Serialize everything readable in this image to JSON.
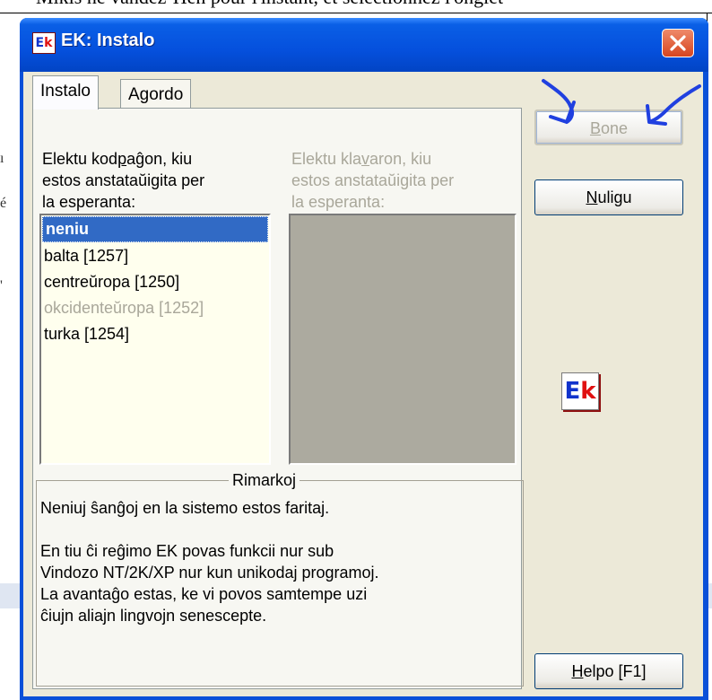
{
  "background": {
    "top_text": "Mikis ne vandez-Hen pour l'instant, et sélectionnez l'onglet"
  },
  "window": {
    "title": "EK: Instalo",
    "icon_text_e": "E",
    "icon_text_k": "k",
    "close_icon": "close-x-icon"
  },
  "tabs": [
    {
      "label": "Instalo"
    },
    {
      "label": "Agordo"
    }
  ],
  "codepage": {
    "label_pre": "Elektu kod",
    "label_ul": "p",
    "label_post": "aĝon, kiu\nestos anstataŭigita per\nla esperanta:",
    "items": [
      {
        "label": "neniu",
        "selected": true
      },
      {
        "label": "balta [1257]"
      },
      {
        "label": "centreŭropa [1250]"
      },
      {
        "label": "okcidenteŭropa [1252]",
        "disabled": true
      },
      {
        "label": "turka [1254]"
      }
    ]
  },
  "keyboard": {
    "label_pre": "Elektu kla",
    "label_ul": "v",
    "label_post": "aron, kiu\nestos anstataŭigita per\nla esperanta:"
  },
  "remarks": {
    "legend": "Rimarkoj",
    "text": "Neniuj ŝanĝoj en la sistemo estos faritaj.\n\nEn tiu ĉi reĝimo EK povas funkcii nur sub\nVindozo NT/2K/XP nur kun unikodaj programoj.\nLa avantaĝo estas, ke vi povos samtempe uzi\nĉiujn aliajn lingvojn senescepte."
  },
  "buttons": {
    "bone_ul": "B",
    "bone_rest": "one",
    "nuligu_ul": "N",
    "nuligu_rest": "uligu",
    "helpo_ul": "H",
    "helpo_rest": "elpo [F1]"
  },
  "logo": {
    "e": "E",
    "k": "k"
  },
  "colors": {
    "titlebar": "#0550dd",
    "selection": "#316ac5",
    "annotation_arrows": "#2040e0"
  }
}
